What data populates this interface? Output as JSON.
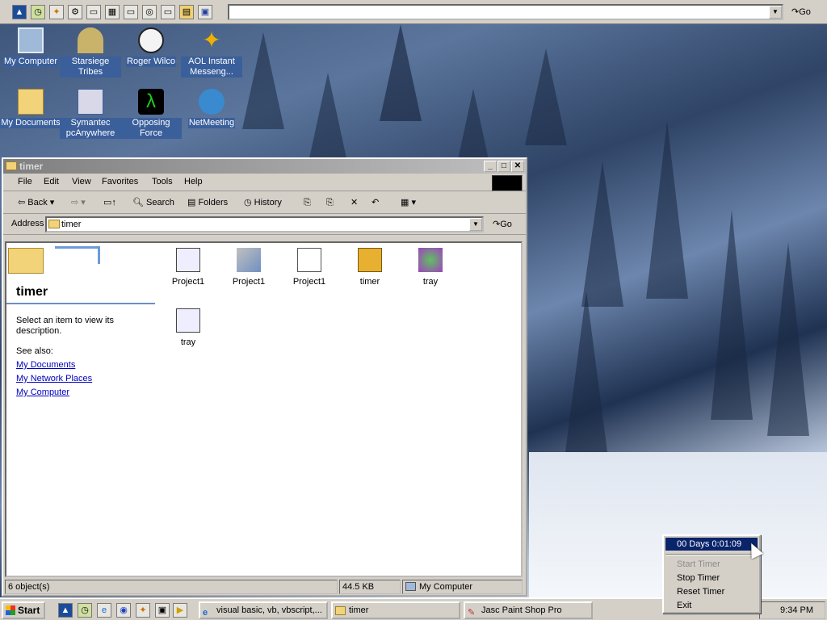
{
  "topbar": {
    "quick_icons": [
      "aol-icon",
      "clock-icon",
      "runner-icon",
      "gear-icon",
      "key-icon",
      "grid-icon",
      "key-icon",
      "globe-icon",
      "key-icon",
      "folder-icon",
      "monitor-icon"
    ],
    "go_label": "Go"
  },
  "desktop": {
    "icons": [
      {
        "label": "My Computer"
      },
      {
        "label": "Starsiege Tribes"
      },
      {
        "label": "Roger Wilco"
      },
      {
        "label": "AOL Instant Messeng..."
      },
      {
        "label": "My Documents"
      },
      {
        "label": "Symantec pcAnywhere"
      },
      {
        "label": "Opposing Force"
      },
      {
        "label": "NetMeeting"
      }
    ]
  },
  "window": {
    "title": "timer",
    "menu": [
      "File",
      "Edit",
      "View",
      "Favorites",
      "Tools",
      "Help"
    ],
    "toolbar": {
      "back": "Back",
      "search": "Search",
      "folders": "Folders",
      "history": "History"
    },
    "address_label": "Address",
    "address_value": "timer",
    "go_label": "Go",
    "left_panel": {
      "folder_title": "timer",
      "description": "Select an item to view its description.",
      "see_also": "See also:",
      "links": [
        "My Documents",
        "My Network Places",
        "My Computer"
      ]
    },
    "files": [
      {
        "name": "Project1"
      },
      {
        "name": "Project1"
      },
      {
        "name": "Project1"
      },
      {
        "name": "timer"
      },
      {
        "name": "tray"
      },
      {
        "name": "tray"
      }
    ],
    "status": {
      "objects": "6 object(s)",
      "size": "44.5 KB",
      "location": "My Computer"
    }
  },
  "taskbar": {
    "start": "Start",
    "tasks": [
      "visual basic, vb, vbscript,...",
      "timer",
      "Jasc Paint Shop Pro"
    ],
    "clock": "9:34 PM"
  },
  "popup": {
    "items": [
      {
        "label": "00 Days 0:01:09"
      },
      {
        "label": "Start Timer"
      },
      {
        "label": "Stop Timer"
      },
      {
        "label": "Reset Timer"
      },
      {
        "label": "Exit"
      }
    ]
  },
  "colors": {
    "titlebar_inactive": "#808080",
    "selection": "#0a246a",
    "link": "#0000c0",
    "desktop_label_bg": "#3a5f9b"
  }
}
